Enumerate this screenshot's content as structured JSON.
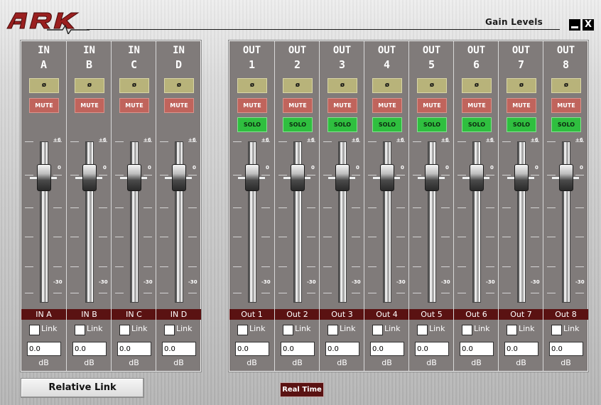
{
  "window": {
    "logo_text": "ARK",
    "title": "Gain Levels",
    "minimize_icon": "minimize-icon",
    "close_label": "X",
    "close_icon": "close-icon"
  },
  "fader_scale": {
    "top": "+6",
    "zero": "0",
    "bottom": "-30"
  },
  "inputs": [
    {
      "line1": "IN",
      "line2": "A",
      "phase_label": "ø",
      "mute_label": "MUTE",
      "name": "IN A",
      "link_label": "Link",
      "link_checked": false,
      "value": "0.0",
      "unit": "dB"
    },
    {
      "line1": "IN",
      "line2": "B",
      "phase_label": "ø",
      "mute_label": "MUTE",
      "name": "IN B",
      "link_label": "Link",
      "link_checked": false,
      "value": "0.0",
      "unit": "dB"
    },
    {
      "line1": "IN",
      "line2": "C",
      "phase_label": "ø",
      "mute_label": "MUTE",
      "name": "IN C",
      "link_label": "Link",
      "link_checked": false,
      "value": "0.0",
      "unit": "dB"
    },
    {
      "line1": "IN",
      "line2": "D",
      "phase_label": "ø",
      "mute_label": "MUTE",
      "name": "IN D",
      "link_label": "Link",
      "link_checked": false,
      "value": "0.0",
      "unit": "dB"
    }
  ],
  "outputs": [
    {
      "line1": "OUT",
      "line2": "1",
      "phase_label": "ø",
      "mute_label": "MUTE",
      "solo_label": "SOLO",
      "name": "Out 1",
      "link_label": "Link",
      "link_checked": false,
      "value": "0.0",
      "unit": "dB"
    },
    {
      "line1": "OUT",
      "line2": "2",
      "phase_label": "ø",
      "mute_label": "MUTE",
      "solo_label": "SOLO",
      "name": "Out 2",
      "link_label": "Link",
      "link_checked": false,
      "value": "0.0",
      "unit": "dB"
    },
    {
      "line1": "OUT",
      "line2": "3",
      "phase_label": "ø",
      "mute_label": "MUTE",
      "solo_label": "SOLO",
      "name": "Out 3",
      "link_label": "Link",
      "link_checked": false,
      "value": "0.0",
      "unit": "dB"
    },
    {
      "line1": "OUT",
      "line2": "4",
      "phase_label": "ø",
      "mute_label": "MUTE",
      "solo_label": "SOLO",
      "name": "Out 4",
      "link_label": "Link",
      "link_checked": false,
      "value": "0.0",
      "unit": "dB"
    },
    {
      "line1": "OUT",
      "line2": "5",
      "phase_label": "ø",
      "mute_label": "MUTE",
      "solo_label": "SOLO",
      "name": "Out 5",
      "link_label": "Link",
      "link_checked": false,
      "value": "0.0",
      "unit": "dB"
    },
    {
      "line1": "OUT",
      "line2": "6",
      "phase_label": "ø",
      "mute_label": "MUTE",
      "solo_label": "SOLO",
      "name": "Out 6",
      "link_label": "Link",
      "link_checked": false,
      "value": "0.0",
      "unit": "dB"
    },
    {
      "line1": "OUT",
      "line2": "7",
      "phase_label": "ø",
      "mute_label": "MUTE",
      "solo_label": "SOLO",
      "name": "Out 7",
      "link_label": "Link",
      "link_checked": false,
      "value": "0.0",
      "unit": "dB"
    },
    {
      "line1": "OUT",
      "line2": "8",
      "phase_label": "ø",
      "mute_label": "MUTE",
      "solo_label": "SOLO",
      "name": "Out 8",
      "link_label": "Link",
      "link_checked": false,
      "value": "0.0",
      "unit": "dB"
    }
  ],
  "footer": {
    "relative_link_label": "Relative Link",
    "real_time_label": "Real Time"
  },
  "colors": {
    "strip_bg": "#807b7a",
    "name_bar": "#5a1212",
    "phase": "#b8b37a",
    "mute": "#c0645c",
    "solo": "#2fbf3f",
    "logo": "#9a1f1f"
  }
}
